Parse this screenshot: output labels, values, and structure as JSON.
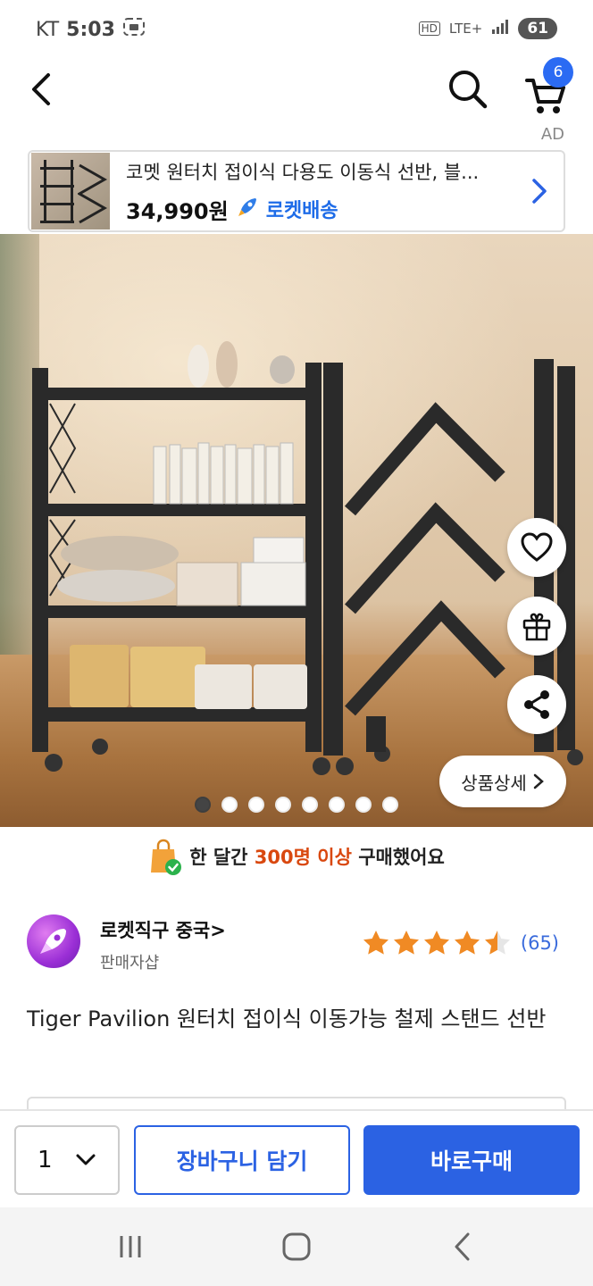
{
  "status_bar": {
    "carrier": "KT",
    "time": "5:03",
    "network": "LTE+",
    "hd": "HD",
    "battery": "61"
  },
  "header": {
    "cart_count": "6"
  },
  "ad": {
    "label": "AD",
    "title": "코멧 원터치 접이식 다용도 이동식 선반, 블...",
    "price": "34,990원",
    "rocket_label": "로켓배송"
  },
  "carousel": {
    "total": 8,
    "active": 0
  },
  "product_image": {
    "detail_button": "상품상세"
  },
  "purchase_notice": {
    "prefix": "한 달간",
    "highlight": "300명 이상",
    "suffix": "구매했어요"
  },
  "seller": {
    "name": "로켓직구 중국>",
    "sub": "판매자샵",
    "rating": 4.5,
    "review_count": "(65)"
  },
  "product": {
    "title": "Tiger Pavilion 원터치 접이식 이동가능 철제 스탠드 선반"
  },
  "bottom_bar": {
    "quantity": "1",
    "add_to_cart": "장바구니 담기",
    "buy_now": "바로구매"
  },
  "colors": {
    "accent": "#2b62e3",
    "highlight": "#d9480f",
    "star": "#f08a24"
  }
}
